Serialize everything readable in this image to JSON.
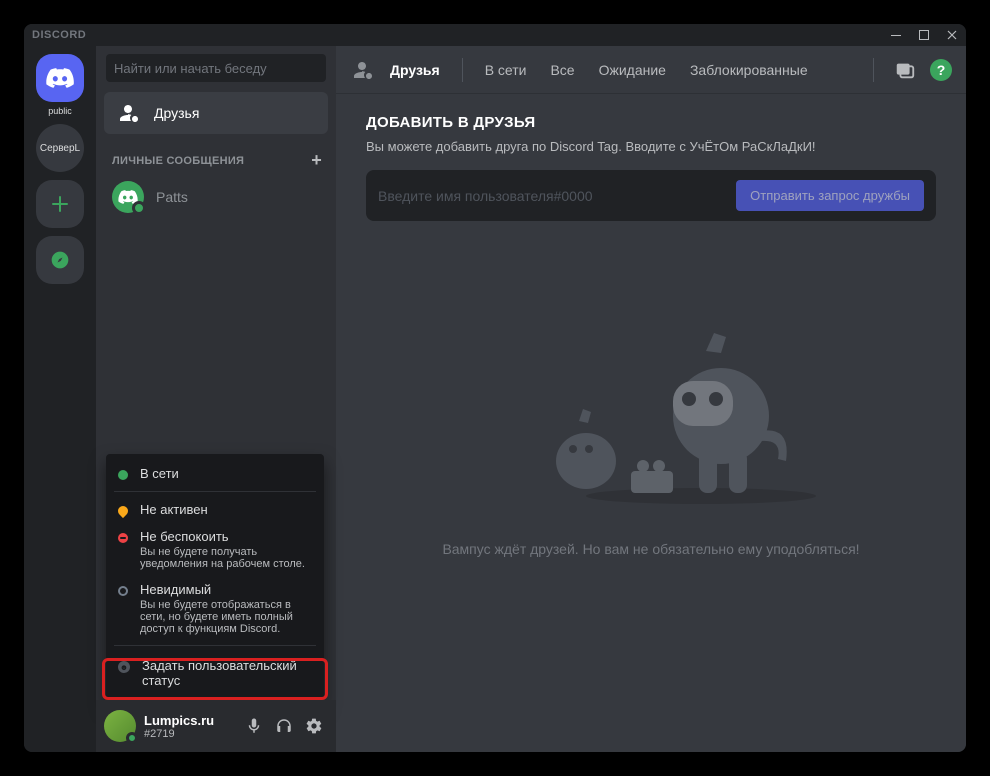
{
  "titlebar": {
    "app_name": "DISCORD"
  },
  "servers": {
    "home_label": "public",
    "server1_label": "СерверL"
  },
  "sidebar": {
    "search_placeholder": "Найти или начать беседу",
    "friends_label": "Друзья",
    "dm_header": "ЛИЧНЫЕ СООБЩЕНИЯ",
    "dm_items": [
      {
        "name": "Patts"
      }
    ]
  },
  "status_menu": {
    "online": "В сети",
    "idle": "Не активен",
    "dnd": "Не беспокоить",
    "dnd_sub": "Вы не будете получать уведомления на рабочем столе.",
    "invisible": "Невидимый",
    "invisible_sub": "Вы не будете отображаться в сети, но будете иметь полный доступ к функциям Discord.",
    "custom": "Задать пользовательский статус"
  },
  "user_panel": {
    "name": "Lumpics.ru",
    "tag": "#2719"
  },
  "main_header": {
    "title": "Друзья",
    "tabs": {
      "online": "В сети",
      "all": "Все",
      "pending": "Ожидание",
      "blocked": "Заблокированные"
    }
  },
  "add_friend": {
    "title": "ДОБАВИТЬ В ДРУЗЬЯ",
    "subtitle": "Вы можете добавить друга по Discord Tag. Вводите с УчЁтОм РаСкЛаДкИ!",
    "placeholder": "Введите имя пользователя#0000",
    "button": "Отправить запрос дружбы"
  },
  "empty_state": {
    "text": "Вампус ждёт друзей. Но вам не обязательно ему уподобляться!"
  }
}
